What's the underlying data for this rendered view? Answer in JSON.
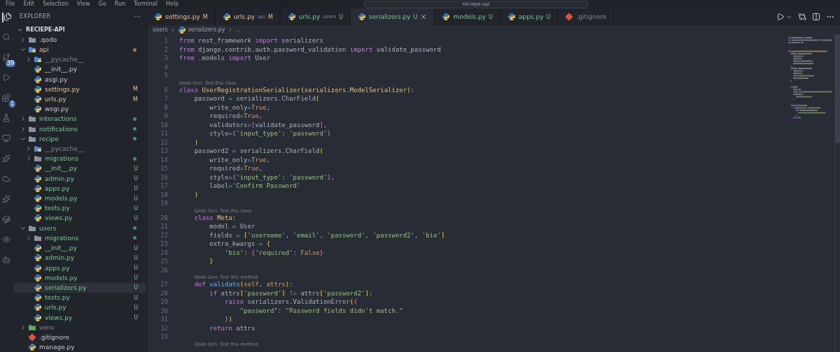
{
  "menu": [
    "File",
    "Edit",
    "Selection",
    "View",
    "Go",
    "Run",
    "Terminal",
    "Help"
  ],
  "title_search": "reciepe-api",
  "activity_bar": [
    {
      "kind": "explorer",
      "selected": true
    },
    {
      "kind": "search",
      "selected": false
    },
    {
      "kind": "source-control",
      "badge": "39",
      "selected": false
    },
    {
      "kind": "run",
      "selected": false
    },
    {
      "kind": "extensions",
      "badge": "1",
      "selected": false
    },
    {
      "kind": "testing",
      "selected": false
    },
    {
      "kind": "remote",
      "selected": false
    },
    {
      "kind": "python",
      "selected": false
    },
    {
      "kind": "cloud",
      "selected": false
    },
    {
      "kind": "copilot",
      "selected": false
    },
    {
      "kind": "docker",
      "selected": false
    },
    {
      "kind": "eye",
      "selected": false
    },
    {
      "kind": "bot",
      "selected": false
    }
  ],
  "sidebar": {
    "title": "EXPLORER",
    "more": "···",
    "section": "RECIEPE-API",
    "items": [
      {
        "name": ".qodo",
        "kind": "folder",
        "expanded": false,
        "selected": false
      },
      {
        "name": "api",
        "kind": "py-folder",
        "expanded": true,
        "modified": true,
        "dot": true,
        "selected": false,
        "children": [
          {
            "name": "__pycache__",
            "kind": "py-folder",
            "expanded": false,
            "ignored": true,
            "selected": false
          },
          {
            "name": "__init__.py",
            "kind": "python",
            "selected": false
          },
          {
            "name": "asgi.py",
            "kind": "python",
            "selected": false
          },
          {
            "name": "settings.py",
            "kind": "python",
            "modified": true,
            "badge": "M",
            "selected": false
          },
          {
            "name": "urls.py",
            "kind": "python",
            "modified": true,
            "badge": "M",
            "selected": false
          },
          {
            "name": "wsgi.py",
            "kind": "python",
            "selected": false
          }
        ]
      },
      {
        "name": "interactions",
        "kind": "folder",
        "expanded": false,
        "untracked": true,
        "dot": true,
        "selected": false
      },
      {
        "name": "notifications",
        "kind": "folder",
        "expanded": false,
        "untracked": true,
        "dot": true,
        "selected": false
      },
      {
        "name": "recipe",
        "kind": "folder",
        "expanded": true,
        "untracked": true,
        "dot": true,
        "selected": false,
        "children": [
          {
            "name": "__pycache__",
            "kind": "py-folder",
            "expanded": false,
            "ignored": true,
            "selected": false
          },
          {
            "name": "migrations",
            "kind": "folder",
            "expanded": false,
            "untracked": true,
            "dot": true,
            "selected": false
          },
          {
            "name": "__init__.py",
            "kind": "python",
            "untracked": true,
            "badge": "U",
            "selected": false
          },
          {
            "name": "admin.py",
            "kind": "python",
            "untracked": true,
            "badge": "U",
            "selected": false
          },
          {
            "name": "apps.py",
            "kind": "python",
            "untracked": true,
            "badge": "U",
            "selected": false
          },
          {
            "name": "models.py",
            "kind": "python",
            "untracked": true,
            "badge": "U",
            "selected": false
          },
          {
            "name": "tests.py",
            "kind": "python",
            "untracked": true,
            "badge": "U",
            "selected": false
          },
          {
            "name": "views.py",
            "kind": "python",
            "untracked": true,
            "badge": "U",
            "selected": false
          }
        ]
      },
      {
        "name": "users",
        "kind": "folder",
        "expanded": true,
        "untracked": true,
        "dot": true,
        "selected": false,
        "children": [
          {
            "name": "migrations",
            "kind": "folder",
            "expanded": false,
            "untracked": true,
            "dot": true,
            "selected": false
          },
          {
            "name": "__init__.py",
            "kind": "python",
            "untracked": true,
            "badge": "U",
            "selected": false
          },
          {
            "name": "admin.py",
            "kind": "python",
            "untracked": true,
            "badge": "U",
            "selected": false
          },
          {
            "name": "apps.py",
            "kind": "python",
            "untracked": true,
            "badge": "U",
            "selected": false
          },
          {
            "name": "models.py",
            "kind": "python",
            "untracked": true,
            "badge": "U",
            "selected": false
          },
          {
            "name": "serializers.py",
            "kind": "python",
            "untracked": true,
            "badge": "U",
            "selected": true
          },
          {
            "name": "tests.py",
            "kind": "python",
            "untracked": true,
            "badge": "U",
            "selected": false
          },
          {
            "name": "urls.py",
            "kind": "python",
            "untracked": true,
            "badge": "U",
            "selected": false
          },
          {
            "name": "views.py",
            "kind": "python",
            "untracked": true,
            "badge": "U",
            "selected": false
          }
        ]
      },
      {
        "name": "venv",
        "kind": "env-folder",
        "expanded": false,
        "ignored": true,
        "selected": false
      },
      {
        "name": ".gitignore",
        "kind": "git",
        "selected": false
      },
      {
        "name": "manage.py",
        "kind": "python",
        "selected": false
      }
    ]
  },
  "tabs": [
    {
      "label": "settings.py",
      "badge": "M",
      "modified": true,
      "kind": "python",
      "selected": false
    },
    {
      "label": "urls.py",
      "detail": "api",
      "badge": "M",
      "modified": true,
      "kind": "python",
      "selected": false
    },
    {
      "label": "urls.py",
      "detail": "users",
      "badge": "U",
      "untracked": true,
      "kind": "python",
      "selected": false
    },
    {
      "label": "serializers.py",
      "badge": "U",
      "untracked": true,
      "kind": "python",
      "selected": true
    },
    {
      "label": "models.py",
      "badge": "U",
      "untracked": true,
      "kind": "python",
      "selected": false
    },
    {
      "label": "apps.py",
      "badge": "U",
      "untracked": true,
      "kind": "python",
      "selected": false
    },
    {
      "label": ".gitignore",
      "ignored": true,
      "kind": "git",
      "selected": false
    }
  ],
  "breadcrumb": [
    {
      "label": "users",
      "kind": "folder"
    },
    {
      "label": "serializers.py",
      "kind": "python"
    },
    {
      "label": "...",
      "kind": "symbol"
    }
  ],
  "code": [
    {
      "kind": "code",
      "n": "1",
      "tokens": [
        {
          "t": "from",
          "kind": "kw"
        },
        {
          "t": " rest_framework ",
          "kind": "pl"
        },
        {
          "t": "import",
          "kind": "kw"
        },
        {
          "t": " serializers",
          "kind": "pl"
        }
      ]
    },
    {
      "kind": "code",
      "n": "2",
      "tokens": [
        {
          "t": "from",
          "kind": "kw"
        },
        {
          "t": " django.contrib.auth.password_validation ",
          "kind": "pl"
        },
        {
          "t": "import",
          "kind": "kw"
        },
        {
          "t": " validate_password",
          "kind": "pl"
        }
      ]
    },
    {
      "kind": "code",
      "n": "3",
      "tokens": [
        {
          "t": "from",
          "kind": "kw"
        },
        {
          "t": " .models ",
          "kind": "pl"
        },
        {
          "t": "import",
          "kind": "kw"
        },
        {
          "t": " User",
          "kind": "pl"
        }
      ]
    },
    {
      "kind": "code",
      "n": "4"
    },
    {
      "kind": "code",
      "n": "5"
    },
    {
      "kind": "lens",
      "text": "Qodo Gen: Test this class"
    },
    {
      "kind": "code",
      "n": "6",
      "tokens": [
        {
          "t": "class ",
          "kind": "kw"
        },
        {
          "t": "UserRegistrationSerializer",
          "kind": "cls"
        },
        {
          "t": "(",
          "kind": "b1"
        },
        {
          "t": "serializers",
          "kind": "cls"
        },
        {
          "t": ".",
          "kind": "pl"
        },
        {
          "t": "ModelSerializer",
          "kind": "cls"
        },
        {
          "t": ")",
          "kind": "b1"
        },
        {
          "t": ":",
          "kind": "pl"
        }
      ]
    },
    {
      "kind": "code",
      "n": "7",
      "tokens": [
        {
          "t": "    password ",
          "kind": "pl"
        },
        {
          "t": "=",
          "kind": "op"
        },
        {
          "t": " serializers.CharField",
          "kind": "pl"
        },
        {
          "t": "(",
          "kind": "b1"
        }
      ]
    },
    {
      "kind": "code",
      "n": "8",
      "tokens": [
        {
          "t": "        write_only",
          "kind": "pl"
        },
        {
          "t": "=",
          "kind": "op"
        },
        {
          "t": "True",
          "kind": "const"
        },
        {
          "t": ",",
          "kind": "pl"
        }
      ]
    },
    {
      "kind": "code",
      "n": "9",
      "tokens": [
        {
          "t": "        required",
          "kind": "pl"
        },
        {
          "t": "=",
          "kind": "op"
        },
        {
          "t": "True",
          "kind": "const"
        },
        {
          "t": ",",
          "kind": "pl"
        }
      ]
    },
    {
      "kind": "code",
      "n": "10",
      "tokens": [
        {
          "t": "        validators",
          "kind": "pl"
        },
        {
          "t": "=",
          "kind": "op"
        },
        {
          "t": "[",
          "kind": "b2"
        },
        {
          "t": "validate_password",
          "kind": "pl"
        },
        {
          "t": "]",
          "kind": "b2"
        },
        {
          "t": ",",
          "kind": "pl"
        }
      ]
    },
    {
      "kind": "code",
      "n": "11",
      "tokens": [
        {
          "t": "        style",
          "kind": "pl"
        },
        {
          "t": "=",
          "kind": "op"
        },
        {
          "t": "{",
          "kind": "b2"
        },
        {
          "t": "'input_type'",
          "kind": "str"
        },
        {
          "t": ": ",
          "kind": "pl"
        },
        {
          "t": "'password'",
          "kind": "str"
        },
        {
          "t": "}",
          "kind": "b2"
        }
      ]
    },
    {
      "kind": "code",
      "n": "12",
      "tokens": [
        {
          "t": "    )",
          "kind": "b1"
        }
      ]
    },
    {
      "kind": "code",
      "n": "13",
      "tokens": [
        {
          "t": "    password2 ",
          "kind": "pl"
        },
        {
          "t": "=",
          "kind": "op"
        },
        {
          "t": " serializers.CharField",
          "kind": "pl"
        },
        {
          "t": "(",
          "kind": "b1"
        }
      ]
    },
    {
      "kind": "code",
      "n": "14",
      "tokens": [
        {
          "t": "        write_only",
          "kind": "pl"
        },
        {
          "t": "=",
          "kind": "op"
        },
        {
          "t": "True",
          "kind": "const"
        },
        {
          "t": ",",
          "kind": "pl"
        }
      ]
    },
    {
      "kind": "code",
      "n": "15",
      "tokens": [
        {
          "t": "        required",
          "kind": "pl"
        },
        {
          "t": "=",
          "kind": "op"
        },
        {
          "t": "True",
          "kind": "const"
        },
        {
          "t": ",",
          "kind": "pl"
        }
      ]
    },
    {
      "kind": "code",
      "n": "16",
      "tokens": [
        {
          "t": "        style",
          "kind": "pl"
        },
        {
          "t": "=",
          "kind": "op"
        },
        {
          "t": "{",
          "kind": "b2"
        },
        {
          "t": "'input_type'",
          "kind": "str"
        },
        {
          "t": ": ",
          "kind": "pl"
        },
        {
          "t": "'password'",
          "kind": "str"
        },
        {
          "t": "}",
          "kind": "b2"
        },
        {
          "t": ",",
          "kind": "pl"
        }
      ]
    },
    {
      "kind": "code",
      "n": "17",
      "tokens": [
        {
          "t": "        label",
          "kind": "pl"
        },
        {
          "t": "=",
          "kind": "op"
        },
        {
          "t": "'Confirm Password'",
          "kind": "str"
        }
      ]
    },
    {
      "kind": "code",
      "n": "18",
      "tokens": [
        {
          "t": "    )",
          "kind": "b1"
        }
      ]
    },
    {
      "kind": "code",
      "n": "19"
    },
    {
      "kind": "lens",
      "text": "Qodo Gen: Test this class"
    },
    {
      "kind": "code",
      "n": "20",
      "tokens": [
        {
          "t": "    class ",
          "kind": "kw"
        },
        {
          "t": "Meta",
          "kind": "cls"
        },
        {
          "t": ":",
          "kind": "pl"
        }
      ]
    },
    {
      "kind": "code",
      "n": "21",
      "tokens": [
        {
          "t": "        model ",
          "kind": "pl"
        },
        {
          "t": "=",
          "kind": "op"
        },
        {
          "t": " User",
          "kind": "pl"
        }
      ]
    },
    {
      "kind": "code",
      "n": "22",
      "tokens": [
        {
          "t": "        fields ",
          "kind": "pl"
        },
        {
          "t": "=",
          "kind": "op"
        },
        {
          "t": " [",
          "kind": "b1"
        },
        {
          "t": "'username'",
          "kind": "str"
        },
        {
          "t": ", ",
          "kind": "pl"
        },
        {
          "t": "'email'",
          "kind": "str"
        },
        {
          "t": ", ",
          "kind": "pl"
        },
        {
          "t": "'password'",
          "kind": "str"
        },
        {
          "t": ", ",
          "kind": "pl"
        },
        {
          "t": "'password2'",
          "kind": "str"
        },
        {
          "t": ", ",
          "kind": "pl"
        },
        {
          "t": "'bio'",
          "kind": "str"
        },
        {
          "t": "]",
          "kind": "b1"
        }
      ]
    },
    {
      "kind": "code",
      "n": "23",
      "tokens": [
        {
          "t": "        extra_kwargs ",
          "kind": "pl"
        },
        {
          "t": "=",
          "kind": "op"
        },
        {
          "t": " {",
          "kind": "b1"
        }
      ]
    },
    {
      "kind": "code",
      "n": "24",
      "tokens": [
        {
          "t": "            'bio'",
          "kind": "str"
        },
        {
          "t": ": ",
          "kind": "pl"
        },
        {
          "t": "{",
          "kind": "b2"
        },
        {
          "t": "'required'",
          "kind": "str"
        },
        {
          "t": ": ",
          "kind": "pl"
        },
        {
          "t": "False",
          "kind": "const"
        },
        {
          "t": "}",
          "kind": "b2"
        }
      ]
    },
    {
      "kind": "code",
      "n": "25",
      "tokens": [
        {
          "t": "        }",
          "kind": "b1"
        }
      ]
    },
    {
      "kind": "code",
      "n": "26"
    },
    {
      "kind": "lens",
      "text": "Qodo Gen: Test this method"
    },
    {
      "kind": "code",
      "n": "27",
      "tokens": [
        {
          "t": "    def ",
          "kind": "kw"
        },
        {
          "t": "validate",
          "kind": "fn"
        },
        {
          "t": "(",
          "kind": "b1"
        },
        {
          "t": "self",
          "kind": "self"
        },
        {
          "t": ", ",
          "kind": "pl"
        },
        {
          "t": "attrs",
          "kind": "self"
        },
        {
          "t": ")",
          "kind": "b1"
        },
        {
          "t": ":",
          "kind": "pl"
        }
      ]
    },
    {
      "kind": "code",
      "n": "28",
      "tokens": [
        {
          "t": "        if",
          "kind": "kw"
        },
        {
          "t": " attrs",
          "kind": "pl"
        },
        {
          "t": "[",
          "kind": "b1"
        },
        {
          "t": "'password'",
          "kind": "str"
        },
        {
          "t": "]",
          "kind": "b1"
        },
        {
          "t": " !=",
          "kind": "op"
        },
        {
          "t": " attrs",
          "kind": "pl"
        },
        {
          "t": "[",
          "kind": "b1"
        },
        {
          "t": "'password2'",
          "kind": "str"
        },
        {
          "t": "]",
          "kind": "b1"
        },
        {
          "t": ":",
          "kind": "pl"
        }
      ]
    },
    {
      "kind": "code",
      "n": "29",
      "tokens": [
        {
          "t": "            raise",
          "kind": "kw"
        },
        {
          "t": " serializers.ValidationError",
          "kind": "pl"
        },
        {
          "t": "(",
          "kind": "b1"
        },
        {
          "t": "{",
          "kind": "b2"
        }
      ]
    },
    {
      "kind": "code",
      "n": "30",
      "tokens": [
        {
          "t": "                \"password\"",
          "kind": "str"
        },
        {
          "t": ": ",
          "kind": "pl"
        },
        {
          "t": "\"Password fields didn't match.\"",
          "kind": "str"
        }
      ]
    },
    {
      "kind": "code",
      "n": "31",
      "tokens": [
        {
          "t": "            }",
          "kind": "b2"
        },
        {
          "t": ")",
          "kind": "b1"
        }
      ]
    },
    {
      "kind": "code",
      "n": "32",
      "tokens": [
        {
          "t": "        return",
          "kind": "kw"
        },
        {
          "t": " attrs",
          "kind": "pl"
        }
      ]
    },
    {
      "kind": "code",
      "n": "33"
    },
    {
      "kind": "lens",
      "text": "Qodo Gen: Test this method"
    }
  ]
}
